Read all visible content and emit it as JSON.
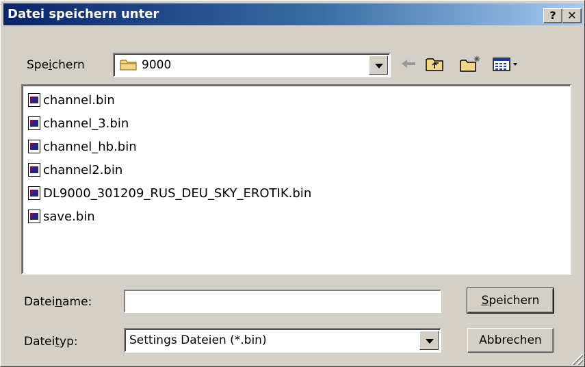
{
  "window": {
    "title": "Datei speichern unter",
    "help_label": "?",
    "close_label": "✕"
  },
  "toolbar": {
    "save_in_label_pre": "Spe",
    "save_in_label_u": "i",
    "save_in_label_post": "chern",
    "current_folder": "9000",
    "icons": [
      "back-arrow-icon",
      "up-folder-icon",
      "new-folder-icon",
      "view-menu-icon"
    ]
  },
  "files": [
    {
      "name": "channel.bin"
    },
    {
      "name": "channel_3.bin"
    },
    {
      "name": "channel_hb.bin"
    },
    {
      "name": "channel2.bin"
    },
    {
      "name": "DL9000_301209_RUS_DEU_SKY_EROTIK.bin"
    },
    {
      "name": "save.bin"
    }
  ],
  "filename": {
    "label_pre": "Datei",
    "label_u": "n",
    "label_post": "ame:",
    "value": ""
  },
  "filetype": {
    "label_pre": "Datei",
    "label_u": "t",
    "label_post": "yp:",
    "value": "Settings Dateien (*.bin)"
  },
  "buttons": {
    "save_u": "S",
    "save_rest": "peichern",
    "cancel": "Abbrechen"
  },
  "colors": {
    "titlebar_start": "#0a246a",
    "titlebar_end": "#a6caf0",
    "face": "#d4d0c8"
  }
}
